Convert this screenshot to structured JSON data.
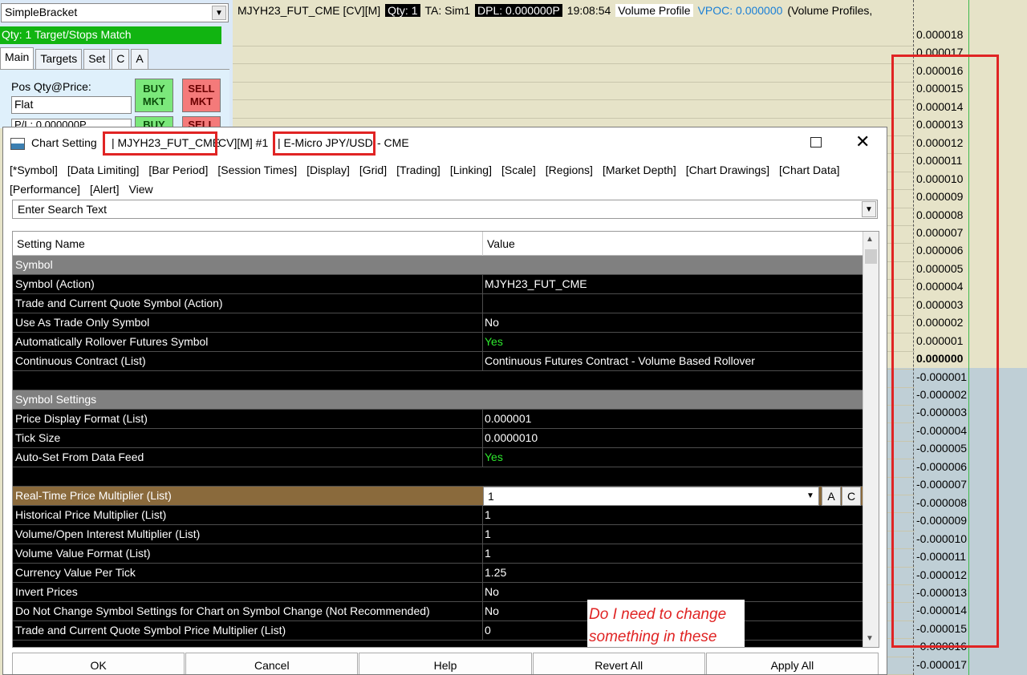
{
  "trade_panel": {
    "strategy": "SimpleBracket",
    "match_status": "Qty: 1 Target/Stops Match",
    "tabs": [
      "Main",
      "Targets",
      "Set",
      "C",
      "A"
    ],
    "pos_label": "Pos Qty@Price:",
    "pos_value": "Flat",
    "pl_value": "P/L: 0.000000P",
    "buy_mkt": "BUY\nMKT",
    "sell_mkt": "SELL\nMKT",
    "buy_2": "BUY",
    "sell_2": "SELL"
  },
  "chart_header": {
    "symbol": "MJYH23_FUT_CME [CV][M]",
    "qty": "Qty: 1",
    "account": "TA: Sim1",
    "dpl": "DPL: 0.000000P",
    "time": "19:08:54",
    "study": "Volume Profile",
    "vpoc": "VPOC: 0.000000",
    "extra": "(Volume Profiles,"
  },
  "price_scale": {
    "ticks_upper": [
      "0.000018",
      "0.000017",
      "0.000016",
      "0.000015",
      "0.000014",
      "0.000013",
      "0.000012",
      "0.000011",
      "0.000010",
      "0.000009",
      "0.000008",
      "0.000007",
      "0.000006",
      "0.000005",
      "0.000004",
      "0.000003",
      "0.000002",
      "0.000001"
    ],
    "zero": "0.000000",
    "ticks_lower": [
      "-0.000001",
      "-0.000002",
      "-0.000003",
      "-0.000004",
      "-0.000005",
      "-0.000006",
      "-0.000007",
      "-0.000008",
      "-0.000009",
      "-0.000010",
      "-0.000011",
      "-0.000012",
      "-0.000013",
      "-0.000014",
      "-0.000015",
      "-0.000016",
      "-0.000017"
    ]
  },
  "dialog": {
    "title_prefix": "Chart Setting",
    "title_symbol": "| MJYH23_FUT_CME",
    "title_mid": "CV][M]  #1",
    "title_desc": "| E-Micro JPY/USD",
    "title_suffix": "- CME",
    "menu": [
      "[*Symbol]",
      "[Data Limiting]",
      "[Bar Period]",
      "[Session Times]",
      "[Display]",
      "[Grid]",
      "[Trading]",
      "[Linking]",
      "[Scale]",
      "[Regions]",
      "[Market Depth]",
      "[Chart Drawings]",
      "[Chart Data]",
      "[Performance]",
      "[Alert]",
      "View"
    ],
    "search_placeholder": "Enter Search Text",
    "col_name": "Setting Name",
    "col_value": "Value",
    "section_symbol": "Symbol",
    "symbol_rows": [
      {
        "name": "Symbol (Action)",
        "value": "MJYH23_FUT_CME"
      },
      {
        "name": "Trade and Current Quote Symbol (Action)",
        "value": ""
      },
      {
        "name": "Use As Trade Only Symbol",
        "value": "No"
      },
      {
        "name": "Automatically Rollover Futures Symbol",
        "value": "Yes"
      },
      {
        "name": "Continuous Contract (List)",
        "value": "Continuous Futures Contract - Volume Based Rollover"
      }
    ],
    "section_settings": "Symbol Settings",
    "settings_rows": [
      {
        "name": "Price Display Format (List)",
        "value": "0.000001"
      },
      {
        "name": "Tick Size",
        "value": "0.0000010"
      },
      {
        "name": "Auto-Set From Data Feed",
        "value": "Yes"
      }
    ],
    "selected_row": {
      "name": "Real-Time Price Multiplier (List)",
      "value": "1",
      "btn_a": "A",
      "btn_c": "C"
    },
    "multiplier_rows": [
      {
        "name": "Historical Price Multiplier (List)",
        "value": "1"
      },
      {
        "name": "Volume/Open Interest Multiplier (List)",
        "value": "1"
      },
      {
        "name": "Volume Value Format (List)",
        "value": "1"
      },
      {
        "name": "Currency Value Per Tick",
        "value": "1.25"
      },
      {
        "name": "Invert Prices",
        "value": "No"
      },
      {
        "name": "Do Not Change Symbol Settings for Chart on Symbol Change (Not Recommended)",
        "value": "No"
      },
      {
        "name": "Trade and Current Quote Symbol Price Multiplier (List)",
        "value": "0"
      }
    ],
    "note": "Do I need to change something in these fields?",
    "buttons": [
      "OK",
      "Cancel",
      "Help",
      "Revert All",
      "Apply All"
    ]
  },
  "colors": {
    "annotation_red": "#e02424",
    "yes_green": "#2ee82e",
    "selected_row": "#8a6a3c"
  }
}
